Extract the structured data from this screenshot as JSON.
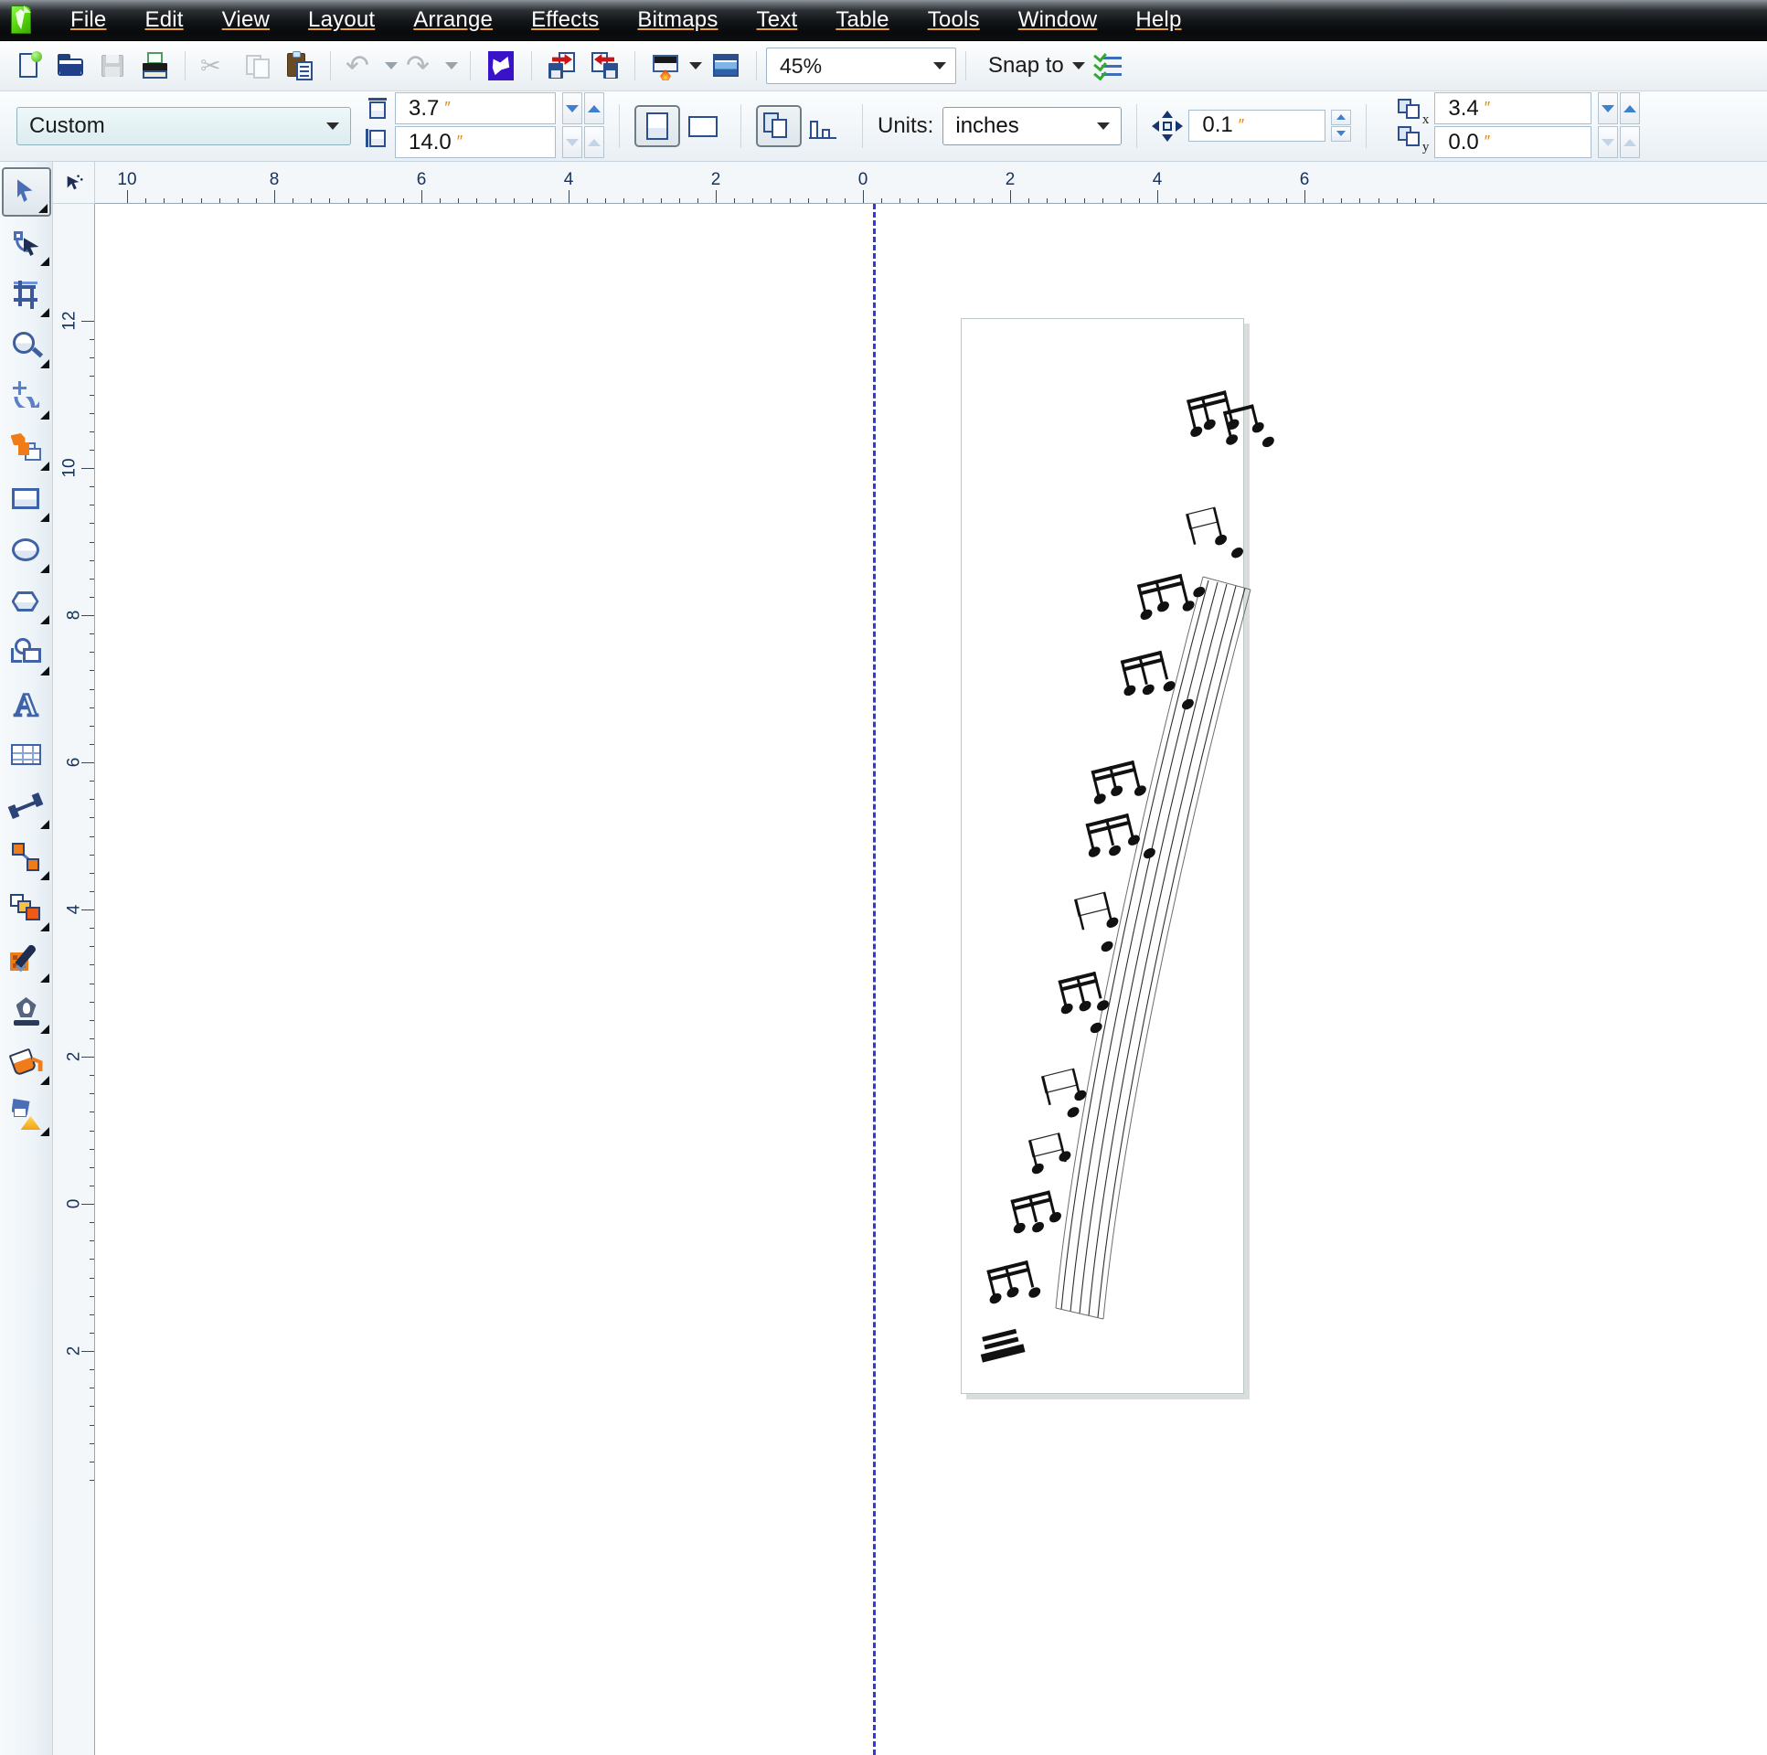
{
  "app": {
    "title": "CorelDRAW",
    "logo_icon": "coreldraw-logo-icon"
  },
  "menubar": {
    "items": [
      {
        "label": "File",
        "accel": "F"
      },
      {
        "label": "Edit",
        "accel": "E"
      },
      {
        "label": "View",
        "accel": "V"
      },
      {
        "label": "Layout",
        "accel": "L"
      },
      {
        "label": "Arrange",
        "accel": "A"
      },
      {
        "label": "Effects",
        "accel": "c"
      },
      {
        "label": "Bitmaps",
        "accel": "B"
      },
      {
        "label": "Text",
        "accel": "x"
      },
      {
        "label": "Table",
        "accel": "T"
      },
      {
        "label": "Tools",
        "accel": "o"
      },
      {
        "label": "Window",
        "accel": "W"
      },
      {
        "label": "Help",
        "accel": "H"
      }
    ]
  },
  "toolbar": {
    "buttons": [
      {
        "name": "new-document-button",
        "icon": "new-document-icon",
        "enabled": true
      },
      {
        "name": "open-document-button",
        "icon": "open-folder-icon",
        "enabled": true
      },
      {
        "name": "save-button",
        "icon": "save-disk-icon",
        "enabled": false
      },
      {
        "name": "print-button",
        "icon": "printer-icon",
        "enabled": true
      },
      {
        "name": "cut-button",
        "icon": "scissors-icon",
        "enabled": false
      },
      {
        "name": "copy-button",
        "icon": "copy-icon",
        "enabled": false
      },
      {
        "name": "paste-button",
        "icon": "clipboard-paste-icon",
        "enabled": true
      },
      {
        "name": "undo-button",
        "icon": "undo-arrow-icon",
        "enabled": false
      },
      {
        "name": "redo-button",
        "icon": "redo-arrow-icon",
        "enabled": false
      },
      {
        "name": "corel-connect-button",
        "icon": "corel-connect-icon",
        "enabled": true
      },
      {
        "name": "import-button",
        "icon": "import-icon",
        "enabled": true
      },
      {
        "name": "export-button",
        "icon": "export-icon",
        "enabled": true
      },
      {
        "name": "application-launcher-button",
        "icon": "app-launcher-icon",
        "enabled": true
      },
      {
        "name": "bitmap-button",
        "icon": "bitmap-image-icon",
        "enabled": true
      }
    ],
    "zoom": {
      "value": "45%",
      "icon": "chevron-down-icon"
    },
    "snap_to": {
      "label": "Snap to",
      "icon": "chevron-down-icon"
    },
    "options": {
      "icon": "options-checklist-icon"
    }
  },
  "propertybar": {
    "paper_type": {
      "value": "Custom",
      "icon": "chevron-down-icon"
    },
    "page_width": {
      "value": "3.7",
      "unit": "″",
      "icon": "page-width-icon"
    },
    "page_height": {
      "value": "14.0",
      "unit": "″",
      "icon": "page-height-icon"
    },
    "orientation": {
      "portrait": {
        "label": "Portrait",
        "active": true
      },
      "landscape": {
        "label": "Landscape",
        "active": false
      }
    },
    "apply_to": {
      "all_pages": {
        "label": "All pages",
        "active": true
      },
      "current_page": {
        "label": "Current page",
        "active": false
      }
    },
    "units": {
      "label": "Units:",
      "value": "inches",
      "icon": "chevron-down-icon"
    },
    "nudge": {
      "value": "0.1",
      "unit": "″",
      "icon": "nudge-offset-icon"
    },
    "duplicate_x": {
      "value": "3.4",
      "unit": "″",
      "icon": "duplicate-x-icon"
    },
    "duplicate_y": {
      "value": "0.0",
      "unit": "″",
      "icon": "duplicate-y-icon"
    }
  },
  "toolbox": {
    "tools": [
      {
        "name": "pick-tool",
        "icon": "pick-arrow-icon",
        "selected": true,
        "flyout": true
      },
      {
        "name": "shape-tool",
        "icon": "shape-node-icon",
        "selected": false,
        "flyout": true
      },
      {
        "name": "crop-tool",
        "icon": "crop-icon",
        "selected": false,
        "flyout": true
      },
      {
        "name": "zoom-tool",
        "icon": "magnifier-icon",
        "selected": false,
        "flyout": true
      },
      {
        "name": "freehand-tool",
        "icon": "freehand-curve-icon",
        "selected": false,
        "flyout": true
      },
      {
        "name": "smart-fill-tool",
        "icon": "smart-fill-icon",
        "selected": false,
        "flyout": true
      },
      {
        "name": "rectangle-tool",
        "icon": "rectangle-icon",
        "selected": false,
        "flyout": true
      },
      {
        "name": "ellipse-tool",
        "icon": "ellipse-icon",
        "selected": false,
        "flyout": true
      },
      {
        "name": "polygon-tool",
        "icon": "polygon-icon",
        "selected": false,
        "flyout": true
      },
      {
        "name": "basic-shapes-tool",
        "icon": "basic-shapes-icon",
        "selected": false,
        "flyout": true
      },
      {
        "name": "text-tool",
        "icon": "text-a-icon",
        "selected": false,
        "flyout": false
      },
      {
        "name": "table-tool",
        "icon": "table-grid-icon",
        "selected": false,
        "flyout": false
      },
      {
        "name": "dimension-tool",
        "icon": "dimension-line-icon",
        "selected": false,
        "flyout": true
      },
      {
        "name": "connector-tool",
        "icon": "connector-line-icon",
        "selected": false,
        "flyout": true
      },
      {
        "name": "blend-tool",
        "icon": "blend-shapes-icon",
        "selected": false,
        "flyout": true
      },
      {
        "name": "color-eyedropper-tool",
        "icon": "eyedropper-icon",
        "selected": false,
        "flyout": true
      },
      {
        "name": "outline-pen-tool",
        "icon": "outline-pen-icon",
        "selected": false,
        "flyout": true
      },
      {
        "name": "fill-tool",
        "icon": "paint-bucket-icon",
        "selected": false,
        "flyout": true
      },
      {
        "name": "interactive-fill-tool",
        "icon": "interactive-fill-icon",
        "selected": false,
        "flyout": true
      }
    ]
  },
  "rulers": {
    "corner_icon": "ruler-origin-icon",
    "horizontal": {
      "labels": [
        "10",
        "8",
        "6",
        "4",
        "2",
        "0",
        "2",
        "4",
        "6"
      ],
      "unit": "inches"
    },
    "vertical": {
      "labels": [
        "12",
        "10",
        "8",
        "6",
        "4",
        "2",
        "0",
        "2"
      ],
      "unit": "inches"
    }
  },
  "canvas": {
    "guideline": {
      "name": "vertical-guideline",
      "orientation": "vertical",
      "color": "#2a3ddb"
    },
    "page": {
      "name": "document-page",
      "width_in": "3.7",
      "height_in": "14.0"
    },
    "artwork": {
      "name": "sheet-music-artwork",
      "description": "rotated music staff with beamed notes",
      "rotation_deg": -14
    }
  }
}
